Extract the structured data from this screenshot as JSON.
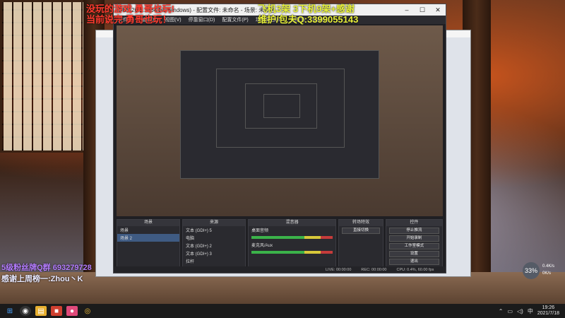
{
  "overlay": {
    "top_red_1": "没玩的游戏 勇哥也玩!",
    "top_red_2": "当前说完 勇哥也玩！",
    "top_yellow_1": "飞机3架 3下机9架+感谢",
    "top_yellow_2": "维护/包夫Q:3399055143",
    "left_purple": "5级粉丝牌Q群 693279728",
    "left_white": "感谢上周榜一:Zhou丶K"
  },
  "window": {
    "title": "OBS 26.1.1 (64-bit, windows) - 配置文件: 未命名 - 场景: 未命名",
    "min": "–",
    "max": "☐",
    "close": "✕",
    "menus": [
      "文件(F)",
      "编辑(E)",
      "视图(V)",
      "停靠窗口(D)",
      "配置文件(P)",
      "场景集合(S)",
      "工具(T)",
      "帮助(H)"
    ]
  },
  "docks": {
    "scenes": {
      "header": "场景",
      "items": [
        "场景",
        "场景 2"
      ]
    },
    "sources": {
      "header": "来源",
      "items": [
        "文本 (GDI+) 5",
        "电脑",
        "文本 (GDI+) 2",
        "文本 (GDI+) 3",
        "拉杆"
      ]
    },
    "mixer": {
      "header": "混音器",
      "items": [
        "桌面音频",
        "麦克风/Aux"
      ]
    },
    "transitions": {
      "header": "转场特效",
      "value": "直接切换"
    },
    "controls": {
      "header": "控件",
      "buttons": [
        "停止推流",
        "开始录制",
        "工作室模式",
        "设置",
        "退出"
      ]
    }
  },
  "status_bar": {
    "live": "LIVE: 00:00:00",
    "rec": "REC: 00:00:00",
    "cpu": "CPU: 0.4%, 60.00 fps"
  },
  "taskbar": {
    "time": "19:26",
    "date": "2021/7/18",
    "icons": [
      "windows-icon",
      "obs-icon",
      "folder-icon",
      "app-icon",
      "app-icon-2",
      "chrome-icon"
    ]
  },
  "badge": {
    "value": "33%"
  },
  "net": {
    "up": "0.4K/s",
    "down": "0K/s"
  }
}
